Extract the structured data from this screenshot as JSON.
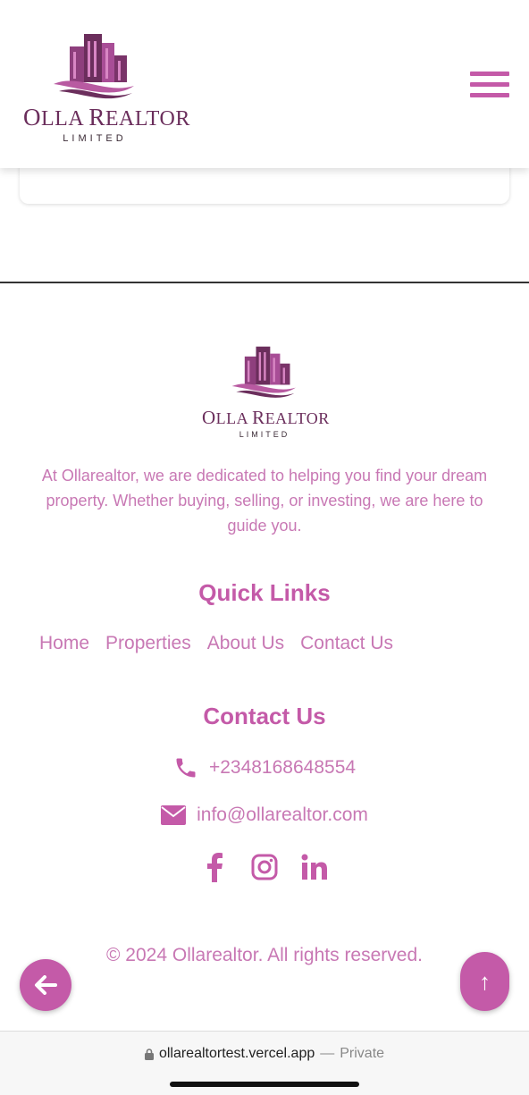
{
  "header": {
    "logo_name_first": "O",
    "logo_name_rest": "LLA ",
    "logo_name_second_first": "R",
    "logo_name_second_rest": "EALTOR",
    "logo_sub": "LIMITED",
    "menu_icon": "hamburger-menu-icon"
  },
  "footer": {
    "logo_name_first": "O",
    "logo_name_rest": "LLA ",
    "logo_name_second_first": "R",
    "logo_name_second_rest": "EALTOR",
    "logo_sub": "LIMITED",
    "about": "At Ollarealtor, we are dedicated to helping you find your dream property. Whether buying, selling, or investing, we are here to guide you.",
    "quick_links_heading": "Quick Links",
    "quick_links": [
      "Home",
      "Properties",
      "About Us",
      "Contact Us"
    ],
    "contact_heading": "Contact Us",
    "phone": "+2348168648554",
    "email": "info@ollarealtor.com",
    "social_icons": [
      "facebook-icon",
      "instagram-icon",
      "linkedin-icon"
    ],
    "copyright": "© 2024 Ollarealtor. All rights reserved."
  },
  "buttons": {
    "back_icon": "arrow-left-icon",
    "top_label": "↑"
  },
  "browser": {
    "url": "ollarealtortest.vercel.app",
    "separator": "—",
    "private_label": "Private"
  },
  "colors": {
    "brand": "#c45aa8",
    "brand_dark": "#6b2e5c",
    "text_light": "#c878b4"
  }
}
